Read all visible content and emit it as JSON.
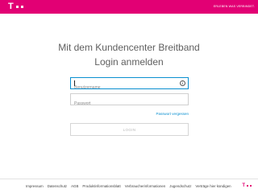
{
  "header": {
    "brand_letter": "T",
    "brand_color": "#e20074",
    "nav_link": "ERLEBEN WAS VERBINDET."
  },
  "main": {
    "title_line1": "Mit dem Kundencenter Breitband",
    "title_line2": "Login anmelden",
    "username_placeholder": "Benutzername",
    "password_placeholder": "Passwort",
    "info_icon": "i",
    "forgot_password": "Passwort vergessen",
    "login_button": "LOGIN",
    "accent_color": "#0a8fd0"
  },
  "footer": {
    "links": [
      "Impressum",
      "Datenschutz",
      "AGB",
      "Produktinformationsblatt",
      "Verbraucherinformationen",
      "Jugendschutz",
      "Verträge hier kündigen"
    ],
    "brand_letter": "T"
  }
}
